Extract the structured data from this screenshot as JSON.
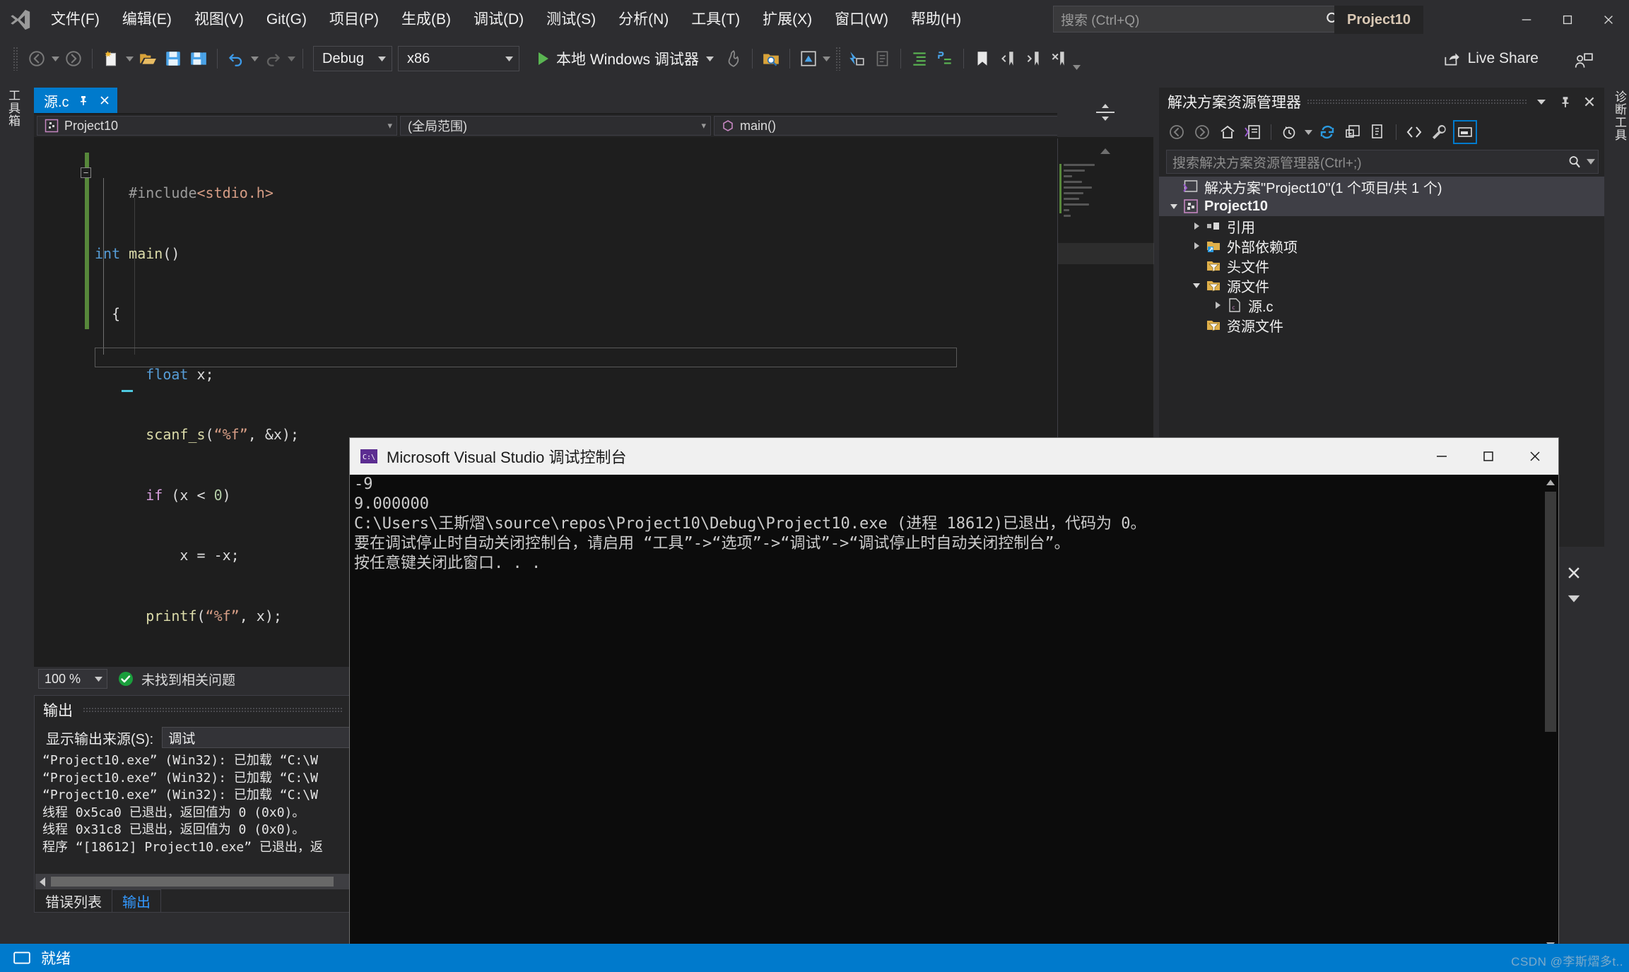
{
  "window": {
    "title": "Project10",
    "minimize_icon": "minimize-icon",
    "maximize_icon": "maximize-icon",
    "close_icon": "close-icon"
  },
  "menu": {
    "items": [
      {
        "label": "文件(F)"
      },
      {
        "label": "编辑(E)"
      },
      {
        "label": "视图(V)"
      },
      {
        "label": "Git(G)"
      },
      {
        "label": "项目(P)"
      },
      {
        "label": "生成(B)"
      },
      {
        "label": "调试(D)"
      },
      {
        "label": "测试(S)"
      },
      {
        "label": "分析(N)"
      },
      {
        "label": "工具(T)"
      },
      {
        "label": "扩展(X)"
      },
      {
        "label": "窗口(W)"
      },
      {
        "label": "帮助(H)"
      }
    ]
  },
  "search": {
    "placeholder": "搜索 (Ctrl+Q)",
    "icon": "search-icon"
  },
  "toolbar": {
    "configuration": "Debug",
    "platform": "x86",
    "run_label": "本地 Windows 调试器",
    "live_share": "Live Share"
  },
  "side_tabs": {
    "left": "工具箱",
    "right": "诊断工具"
  },
  "editor": {
    "tab_name": "源.c",
    "scope": "(全局范围)",
    "member": "main()",
    "zoom": "100 %",
    "status": "未找到相关问题",
    "code": [
      {
        "indent": 2,
        "tokens": [
          {
            "t": "#include",
            "c": "pp"
          },
          {
            "t": "<stdio.h>",
            "c": "str"
          }
        ]
      },
      {
        "indent": 0,
        "tokens": [
          {
            "t": "int",
            "c": "kw"
          },
          {
            "t": " ",
            "c": "pl"
          },
          {
            "t": "main",
            "c": "fn"
          },
          {
            "t": "()",
            "c": "pl"
          }
        ]
      },
      {
        "indent": 1,
        "tokens": [
          {
            "t": "{",
            "c": "pl"
          }
        ]
      },
      {
        "indent": 3,
        "tokens": [
          {
            "t": "float",
            "c": "kw"
          },
          {
            "t": " x;",
            "c": "pl"
          }
        ]
      },
      {
        "indent": 3,
        "tokens": [
          {
            "t": "scanf_s",
            "c": "fn"
          },
          {
            "t": "(",
            "c": "pl"
          },
          {
            "t": "“%f”",
            "c": "str"
          },
          {
            "t": ", &x);",
            "c": "pl"
          }
        ]
      },
      {
        "indent": 3,
        "tokens": [
          {
            "t": "if",
            "c": "kw2"
          },
          {
            "t": " (x ",
            "c": "pl"
          },
          {
            "t": "<",
            "c": "pl"
          },
          {
            "t": " ",
            "c": "pl"
          },
          {
            "t": "0",
            "c": "num"
          },
          {
            "t": ")",
            "c": "pl"
          }
        ]
      },
      {
        "indent": 5,
        "tokens": [
          {
            "t": "x = -x;",
            "c": "pl"
          }
        ]
      },
      {
        "indent": 3,
        "tokens": [
          {
            "t": "printf",
            "c": "fn"
          },
          {
            "t": "(",
            "c": "pl"
          },
          {
            "t": "“%f”",
            "c": "str"
          },
          {
            "t": ", x);",
            "c": "pl"
          }
        ]
      },
      {
        "indent": 3,
        "tokens": []
      },
      {
        "indent": 1,
        "tokens": [
          {
            "t": "}",
            "c": "pl"
          }
        ]
      }
    ]
  },
  "output": {
    "title": "输出",
    "source_label": "显示输出来源(S):",
    "source_value": "调试",
    "lines": [
      "“Project10.exe” (Win32): 已加载 “C:\\W",
      "“Project10.exe” (Win32): 已加载 “C:\\W",
      "“Project10.exe” (Win32): 已加载 “C:\\W",
      "线程 0x5ca0 已退出，返回值为 0 (0x0)。",
      "线程 0x31c8 已退出，返回值为 0 (0x0)。",
      "程序 “[18612] Project10.exe” 已退出，返"
    ],
    "tabs": [
      {
        "label": "错误列表",
        "active": false
      },
      {
        "label": "输出",
        "active": true
      }
    ]
  },
  "solution_explorer": {
    "title": "解决方案资源管理器",
    "search_placeholder": "搜索解决方案资源管理器(Ctrl+;)",
    "toolbar_icons": [
      "back-icon",
      "forward-icon",
      "home-icon",
      "solution-view-icon",
      "pending-changes-icon",
      "refresh-icon",
      "collapse-all-icon",
      "show-all-files-icon",
      "view-code-icon",
      "properties-icon",
      "preview-icon"
    ],
    "header_icons": [
      "chevron-down-icon",
      "pin-icon",
      "close-icon"
    ],
    "tree": [
      {
        "label": "解决方案\"Project10\"(1 个项目/共 1 个)",
        "depth": 0,
        "twisty": "none",
        "icon": "solution-icon",
        "state": "selected-soft"
      },
      {
        "label": "Project10",
        "depth": 1,
        "twisty": "expanded",
        "icon": "cpp-project-icon",
        "state": "selected"
      },
      {
        "label": "引用",
        "depth": 2,
        "twisty": "collapsed",
        "icon": "references-icon",
        "state": "none"
      },
      {
        "label": "外部依赖项",
        "depth": 2,
        "twisty": "collapsed",
        "icon": "external-deps-icon",
        "state": "none"
      },
      {
        "label": "头文件",
        "depth": 2,
        "twisty": "none",
        "icon": "filter-folder-icon",
        "state": "none"
      },
      {
        "label": "源文件",
        "depth": 2,
        "twisty": "expanded",
        "icon": "filter-folder-icon",
        "state": "none"
      },
      {
        "label": "源.c",
        "depth": 3,
        "twisty": "collapsed",
        "icon": "c-file-icon",
        "state": "none"
      },
      {
        "label": "资源文件",
        "depth": 2,
        "twisty": "none",
        "icon": "filter-folder-icon",
        "state": "none"
      }
    ]
  },
  "console": {
    "title": "Microsoft Visual Studio 调试控制台",
    "icon": "console-icon",
    "lines": [
      "-9",
      "9.000000",
      "C:\\Users\\王斯熠\\source\\repos\\Project10\\Debug\\Project10.exe (进程 18612)已退出，代码为 0。",
      "要在调试停止时自动关闭控制台，请启用 “工具”->“选项”->“调试”->“调试停止时自动关闭控制台”。",
      "按任意键关闭此窗口. . ."
    ],
    "buttons": {
      "minimize": "minimize-icon",
      "maximize": "maximize-icon",
      "close": "close-icon"
    }
  },
  "statusbar": {
    "text": "就绪",
    "icon": "ready-icon"
  },
  "watermark": "CSDN @李斯熠多t..",
  "colors": {
    "accent": "#007acc",
    "chrome": "#2d2d30",
    "editor_bg": "#1e1e1e",
    "console_bg": "#0c0c0c",
    "change_bar": "#57873a"
  }
}
